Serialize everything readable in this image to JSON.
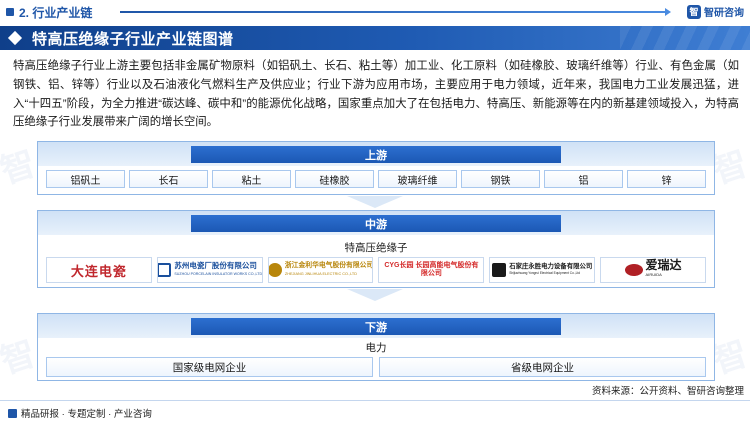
{
  "header": {
    "section_label": "2. 行业产业链",
    "brand_name": "智研咨询",
    "brand_logo_text": "智",
    "accent_color": "#1f56a8"
  },
  "title": "特高压绝缘子行业产业链图谱",
  "intro": "特高压绝缘子行业上游主要包括非金属矿物原料（如铝矾土、长石、粘土等）加工业、化工原料（如硅橡胶、玻璃纤维等）行业、有色金属（如钢铁、铝、锌等）行业以及石油液化气燃料生产及供应业；行业下游为应用市场，主要应用于电力领域，近年来，我国电力工业发展迅猛，进入“十四五”阶段，为全力推进“碳达峰、碳中和”的能源优化战略，国家重点加大了在包括电力、特高压、新能源等在内的新基建领域投入，为特高压绝缘子行业发展带来广阔的增长空间。",
  "upstream": {
    "label": "上游",
    "items": [
      "铝矾土",
      "长石",
      "粘土",
      "硅橡胶",
      "玻璃纤维",
      "钢铁",
      "铝",
      "锌"
    ]
  },
  "midstream": {
    "label": "中游",
    "sublabel": "特高压绝缘子",
    "companies": [
      {
        "name": "大连电瓷",
        "sub": "",
        "color": "#c0272d",
        "icon": "company-logo-icon"
      },
      {
        "name": "苏州电瓷厂股份有限公司",
        "sub": "SUZHOU PORCELAIN INSULATOR WORKS CO.,LTD",
        "color": "#1a4f9c",
        "icon": "company-logo-icon"
      },
      {
        "name": "浙江金利华电气股份有限公司",
        "sub": "ZHEJIANG JINLIHUA ELECTRIC CO.,LTD",
        "color": "#b8860b",
        "icon": "company-logo-icon"
      },
      {
        "name": "CYG长园 长园高能电气股份有限公司",
        "sub": "",
        "color": "#d42a2a",
        "icon": "company-logo-icon"
      },
      {
        "name": "石家庄永胜电力设备有限公司",
        "sub": "Shijiazhuang Yongrui Electrical Equipment Co.,Ltd",
        "color": "#1a1a1a",
        "icon": "company-logo-icon"
      },
      {
        "name": "爱瑞达",
        "sub": "AIRUIDA",
        "color": "#b02025",
        "icon": "company-logo-icon"
      }
    ]
  },
  "downstream": {
    "label": "下游",
    "sublabel": "电力",
    "items": [
      "国家级电网企业",
      "省级电网企业"
    ]
  },
  "source": "资料来源：公开资料、智研咨询整理",
  "footer": "精品研报 · 专题定制 · 产业咨询"
}
